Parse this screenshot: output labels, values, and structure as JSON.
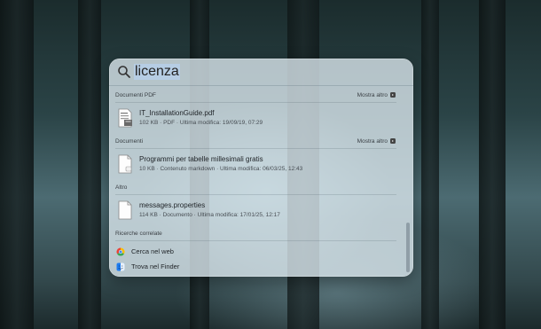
{
  "search": {
    "query": "licenza"
  },
  "sections": {
    "pdf": {
      "title": "Documenti PDF",
      "more": "Mostra altro",
      "items": [
        {
          "name": "IT_InstallationGuide.pdf",
          "meta": "102 KB · PDF · Ultima modifica: 19/09/19, 07:29"
        }
      ]
    },
    "documents": {
      "title": "Documenti",
      "more": "Mostra altro",
      "items": [
        {
          "name": "Programmi per tabelle millesimali gratis",
          "meta": "10 KB · Contenuto markdown · Ultima modifica: 06/03/25, 12:43"
        }
      ]
    },
    "other": {
      "title": "Altro",
      "items": [
        {
          "name": "messages.properties",
          "meta": "114 KB · Documento · Ultima modifica: 17/01/25, 12:17"
        }
      ]
    },
    "related": {
      "title": "Ricerche correlate",
      "items": [
        {
          "label": "Cerca nel web",
          "icon": "chrome-icon"
        },
        {
          "label": "Trova nel Finder",
          "icon": "finder-icon"
        }
      ]
    }
  }
}
